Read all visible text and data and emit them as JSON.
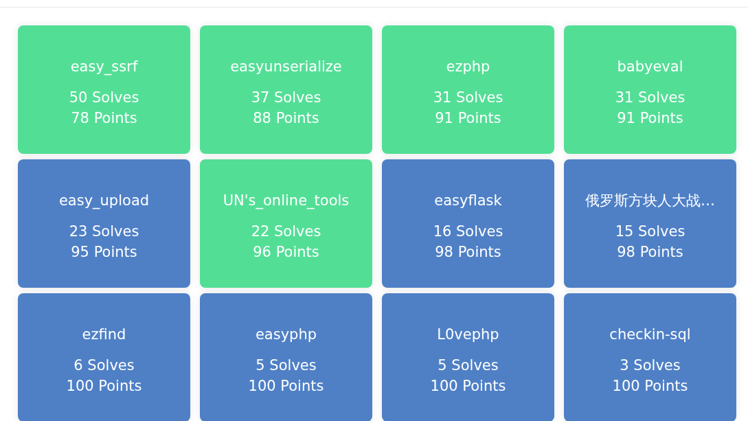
{
  "challenges": [
    {
      "name": "easy_ssrf",
      "solves": "50 Solves",
      "points": "78 Points",
      "solved": true
    },
    {
      "name": "easyunserialize",
      "solves": "37 Solves",
      "points": "88 Points",
      "solved": true
    },
    {
      "name": "ezphp",
      "solves": "31 Solves",
      "points": "91 Points",
      "solved": true
    },
    {
      "name": "babyeval",
      "solves": "31 Solves",
      "points": "91 Points",
      "solved": true
    },
    {
      "name": "easy_upload",
      "solves": "23 Solves",
      "points": "95 Points",
      "solved": false
    },
    {
      "name": "UN's_online_tools",
      "solves": "22 Solves",
      "points": "96 Points",
      "solved": true
    },
    {
      "name": "easyflask",
      "solves": "16 Solves",
      "points": "98 Points",
      "solved": false
    },
    {
      "name": "俄罗斯方块人大战…",
      "solves": "15 Solves",
      "points": "98 Points",
      "solved": false
    },
    {
      "name": "ezfind",
      "solves": "6 Solves",
      "points": "100 Points",
      "solved": false
    },
    {
      "name": "easyphp",
      "solves": "5 Solves",
      "points": "100 Points",
      "solved": false
    },
    {
      "name": "L0vephp",
      "solves": "5 Solves",
      "points": "100 Points",
      "solved": false
    },
    {
      "name": "checkin-sql",
      "solves": "3 Solves",
      "points": "100 Points",
      "solved": false
    }
  ]
}
